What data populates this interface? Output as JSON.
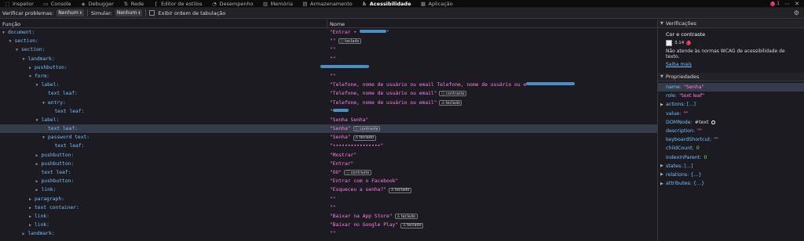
{
  "tabs": [
    {
      "label": "Inspetor",
      "icon": "inspector-icon",
      "glyph": "⬚"
    },
    {
      "label": "Console",
      "icon": "console-icon",
      "glyph": "▭"
    },
    {
      "label": "Debugger",
      "icon": "debugger-icon",
      "glyph": "◈"
    },
    {
      "label": "Rede",
      "icon": "network-icon",
      "glyph": "⇅"
    },
    {
      "label": "Editor de estilos",
      "icon": "style-editor-icon",
      "glyph": "{"
    },
    {
      "label": "Desempenho",
      "icon": "performance-icon",
      "glyph": "◔"
    },
    {
      "label": "Memória",
      "icon": "memory-icon",
      "glyph": "▥"
    },
    {
      "label": "Armazenamento",
      "icon": "storage-icon",
      "glyph": "▤"
    },
    {
      "label": "Acessibilidade",
      "icon": "accessibility-icon",
      "glyph": "♿"
    },
    {
      "label": "Aplicação",
      "icon": "application-icon",
      "glyph": "▦"
    }
  ],
  "active_tab_index": 8,
  "error_count": "1",
  "toolbar": {
    "check_label": "Verificar problemas:",
    "check_value": "Nenhum",
    "simulate_label": "Simular:",
    "simulate_value": "Nenhum",
    "tab_order_label": "Exibir ordem de tabulação"
  },
  "tree": {
    "col_role": "Função",
    "col_name": "Nome",
    "rows": [
      {
        "indent": 0,
        "twisty": "open",
        "role": "document:",
        "name": "\"Entrar • ",
        "blur": 34,
        "name_after": "\""
      },
      {
        "indent": 1,
        "twisty": "open",
        "role": "section:",
        "name": "\"\"",
        "badge": "teclado",
        "badge_icon": "info"
      },
      {
        "indent": 2,
        "twisty": "open",
        "role": "section:",
        "name": "\"\""
      },
      {
        "indent": 3,
        "twisty": "open",
        "role": "landmark:",
        "name": "\"\""
      },
      {
        "indent": 4,
        "twisty": "closed",
        "role": "pushbutton:",
        "name": "",
        "blur_only": 62
      },
      {
        "indent": 4,
        "twisty": "open",
        "role": "form:",
        "name": "\"\""
      },
      {
        "indent": 5,
        "twisty": "open",
        "role": "label:",
        "name": "\"Telefone, nome de usuário ou email Telefone, nome de usuário ou e",
        "blur": 62,
        "name_after": ""
      },
      {
        "indent": 6,
        "twisty": "none",
        "role": "text leaf:",
        "name": "\"Telefone, nome de usuário ou email\"",
        "badge": "contraste",
        "badge_icon": "info"
      },
      {
        "indent": 6,
        "twisty": "open",
        "role": "entry:",
        "name": "\"Telefone, nome de usuário ou email\"",
        "badge": "teclado",
        "badge_icon": "warn"
      },
      {
        "indent": 7,
        "twisty": "none",
        "role": "text leaf:",
        "name": "\"",
        "blur": 20,
        "name_after": ""
      },
      {
        "indent": 5,
        "twisty": "open",
        "role": "label:",
        "name": "\"Senha Senha\""
      },
      {
        "indent": 6,
        "twisty": "none",
        "role": "text leaf:",
        "name": "\"Senha\"",
        "badge": "contraste",
        "badge_icon": "info",
        "selected": true
      },
      {
        "indent": 6,
        "twisty": "open",
        "role": "password text:",
        "name": "\"Senha\"",
        "badge": "teclado",
        "badge_icon": "warn"
      },
      {
        "indent": 7,
        "twisty": "none",
        "role": "text leaf:",
        "name": "\"••••••••••••••••\""
      },
      {
        "indent": 5,
        "twisty": "closed",
        "role": "pushbutton:",
        "name": "\"Mostrar\""
      },
      {
        "indent": 5,
        "twisty": "closed",
        "role": "pushbutton:",
        "name": "\"Entrar\""
      },
      {
        "indent": 5,
        "twisty": "none",
        "role": "text leaf:",
        "name": "\"OU\"",
        "badge": "contraste",
        "badge_icon": "info"
      },
      {
        "indent": 5,
        "twisty": "closed",
        "role": "pushbutton:",
        "name": "\"Entrar com o Facebook\""
      },
      {
        "indent": 5,
        "twisty": "closed",
        "role": "link:",
        "name": "\"Esqueceu a senha?\"",
        "badge": "teclado",
        "badge_icon": "warn"
      },
      {
        "indent": 4,
        "twisty": "closed",
        "role": "paragraph:",
        "name": "\"\""
      },
      {
        "indent": 4,
        "twisty": "closed",
        "role": "text container:",
        "name": "\"\""
      },
      {
        "indent": 4,
        "twisty": "closed",
        "role": "link:",
        "name": "\"Baixar na App Store\"",
        "badge": "teclado",
        "badge_icon": "warn"
      },
      {
        "indent": 4,
        "twisty": "closed",
        "role": "link:",
        "name": "\"Baixar no Google Play\"",
        "badge": "teclado",
        "badge_icon": "warn"
      },
      {
        "indent": 3,
        "twisty": "closed",
        "role": "landmark:",
        "name": "\"\""
      }
    ]
  },
  "sidebar": {
    "checks_title": "Verificações",
    "contrast_title": "Cor e contraste",
    "contrast_ratio": "3.14",
    "contrast_desc": "Não atende às normas WCAG de acessibilidade de texto.",
    "learn_more": "Saiba mais",
    "props_title": "Propriedades",
    "props": [
      {
        "key": "name:",
        "value": "\"Senha\"",
        "kind": "str",
        "selected": true
      },
      {
        "key": "role:",
        "value": "\"text leaf\"",
        "kind": "str"
      },
      {
        "key": "actions: […]",
        "value": "",
        "kind": "exp"
      },
      {
        "key": "value:",
        "value": "\"\"",
        "kind": "str"
      },
      {
        "key": "DOMNode:",
        "value": "#text",
        "kind": "plain",
        "ring": true
      },
      {
        "key": "description:",
        "value": "\"\"",
        "kind": "str"
      },
      {
        "key": "keyboardShortcut:",
        "value": "\"\"",
        "kind": "str"
      },
      {
        "key": "childCount:",
        "value": "0",
        "kind": "num"
      },
      {
        "key": "indexInParent:",
        "value": "0",
        "kind": "num"
      },
      {
        "key": "states: […]",
        "value": "",
        "kind": "exp"
      },
      {
        "key": "relations: {…}",
        "value": "",
        "kind": "exp"
      },
      {
        "key": "attributes: {…}",
        "value": "",
        "kind": "exp"
      }
    ]
  },
  "colors": {
    "role": "#75bfff",
    "name": "#ff7de9",
    "selection": "#353b48",
    "background": "#1c1b22"
  }
}
